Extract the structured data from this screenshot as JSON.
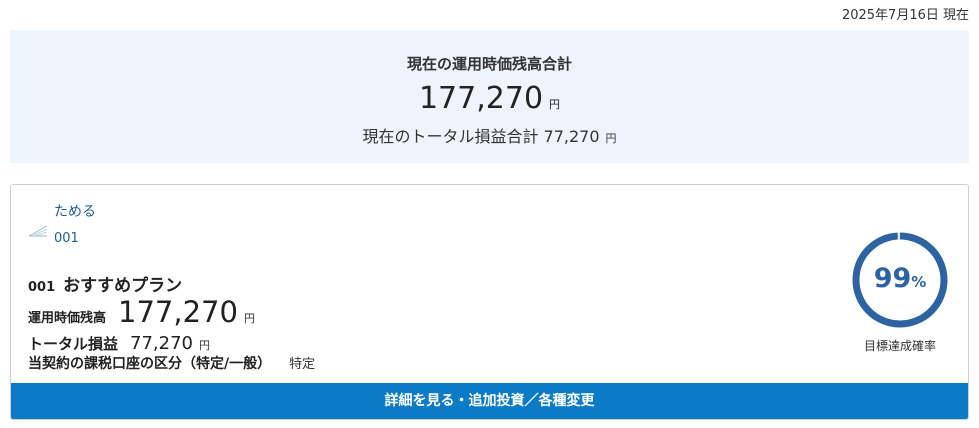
{
  "header": {
    "date_label": "2025年7月16日 現在"
  },
  "summary": {
    "title": "現在の運用時価残高合計",
    "amount": "177,270",
    "amount_unit": "円",
    "total_label": "現在のトータル損益合計 77,270",
    "total_unit": "円"
  },
  "plan": {
    "tag": "ためる",
    "tag_code": "001",
    "code": "001",
    "name": "おすすめプラン",
    "balance_label": "運用時価残高",
    "balance_value": "177,270",
    "balance_unit": "円",
    "profit_label": "トータル損益",
    "profit_value": "77,270",
    "profit_unit": "円",
    "tax_label": "当契約の課税口座の区分（特定/一般）",
    "tax_value": "特定",
    "goal": {
      "value": "99",
      "unit": "%",
      "fraction": 0.99,
      "label": "目標達成確率",
      "color": "#2d62a3",
      "track_color": "#dfe8f3"
    },
    "detail_button": "詳細を見る・追加投資／各種変更"
  }
}
